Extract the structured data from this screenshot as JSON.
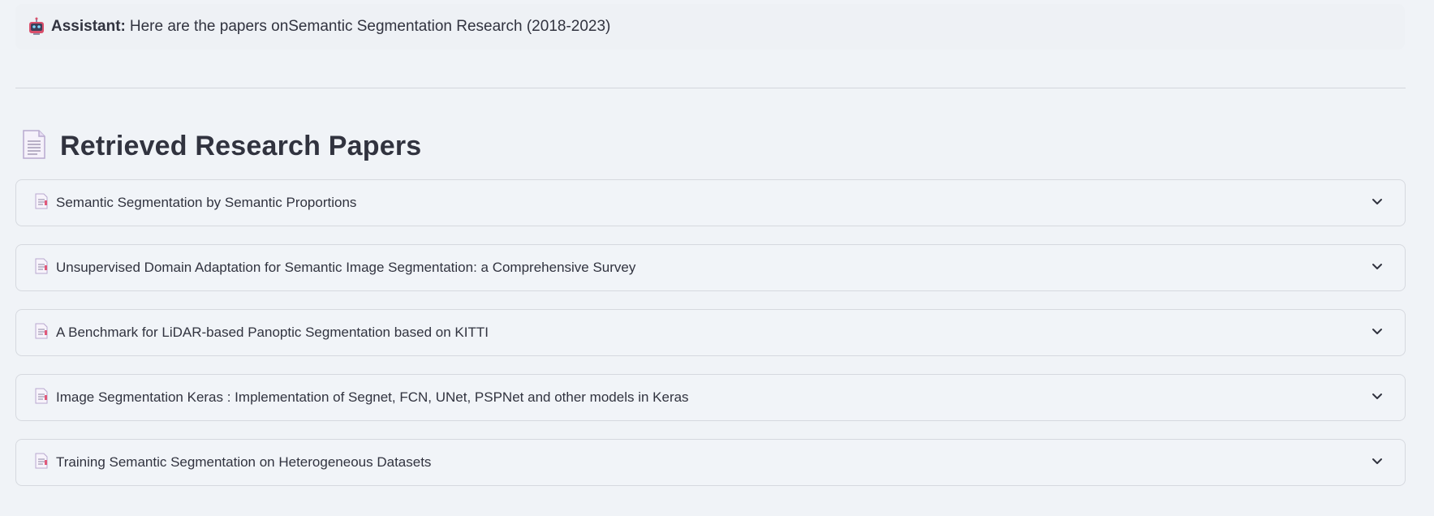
{
  "chat": {
    "speaker": "Assistant:",
    "message": "Here are the papers onSemantic Segmentation Research (2018-2023)"
  },
  "papers_section": {
    "heading": "Retrieved Research Papers",
    "icon": "page-facing-up-icon",
    "items": [
      {
        "title": "Semantic Segmentation by Semantic Proportions",
        "expanded": false
      },
      {
        "title": "Unsupervised Domain Adaptation for Semantic Image Segmentation: a Comprehensive Survey",
        "expanded": false
      },
      {
        "title": "A Benchmark for LiDAR-based Panoptic Segmentation based on KITTI",
        "expanded": false
      },
      {
        "title": "Image Segmentation Keras : Implementation of Segnet, FCN, UNet, PSPNet and other models in Keras",
        "expanded": false
      },
      {
        "title": "Training Semantic Segmentation on Heterogeneous Datasets",
        "expanded": false
      }
    ]
  },
  "icons": {
    "assistant": "robot-icon",
    "paper": "bookmark-tabs-icon",
    "expand": "chevron-down-icon"
  }
}
